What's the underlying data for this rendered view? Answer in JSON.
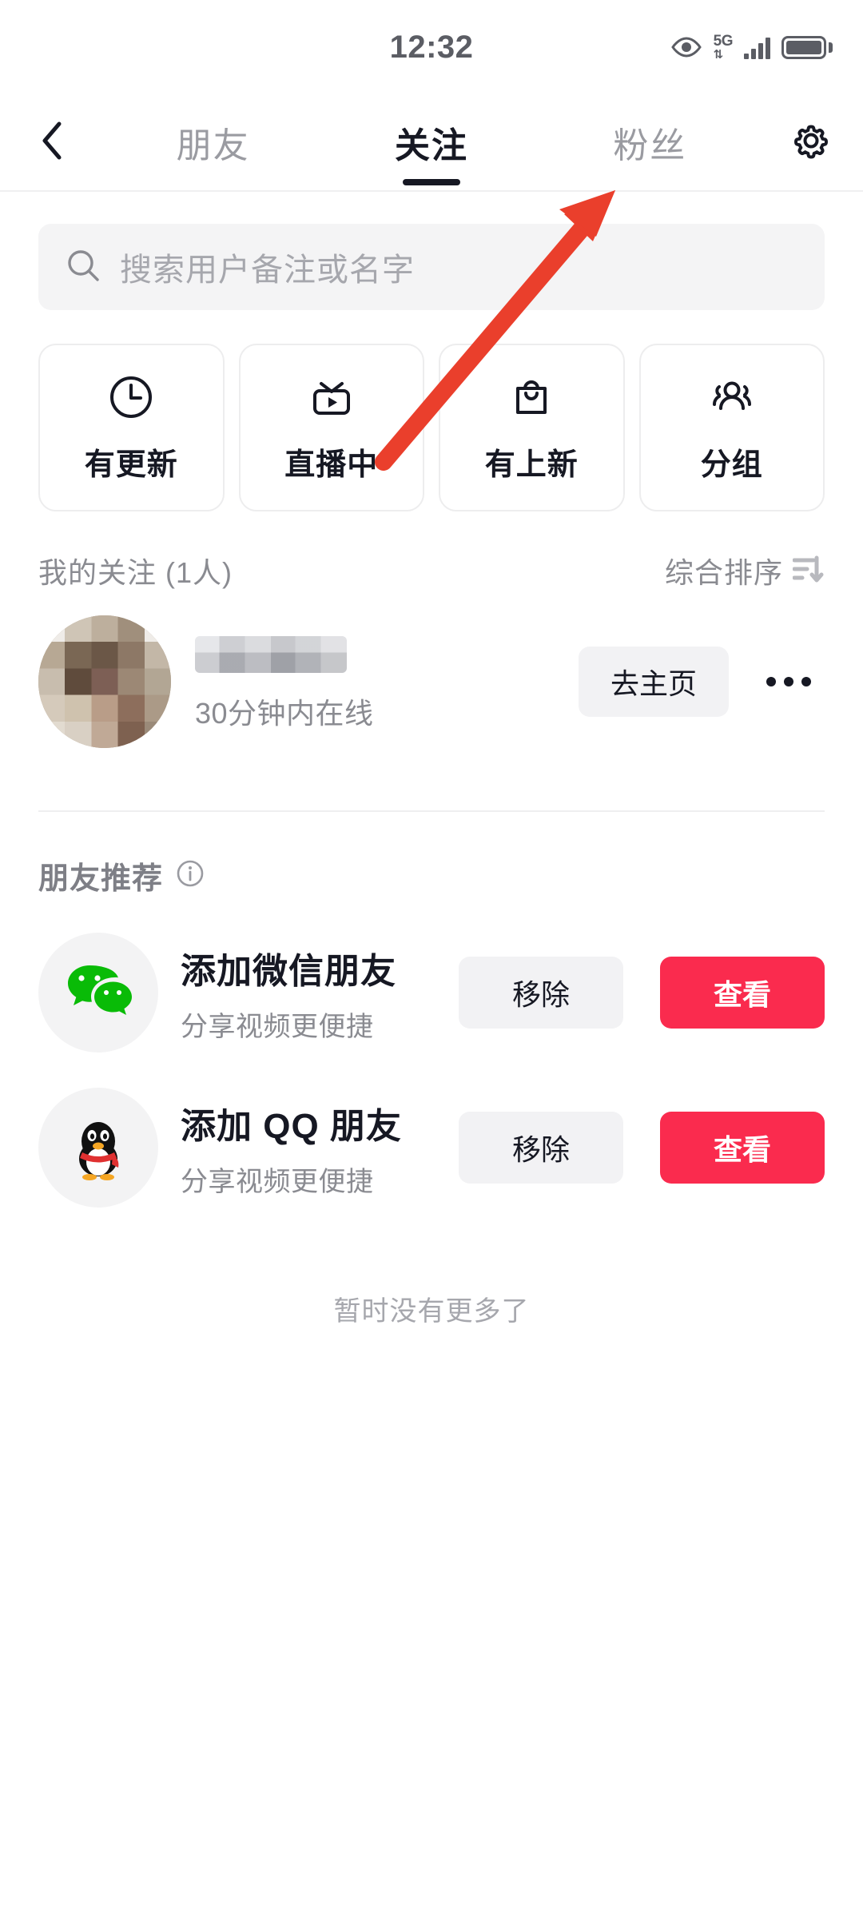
{
  "status_bar": {
    "time": "12:32",
    "network_label": "5G",
    "network_arrows": "⇅",
    "icons": [
      "eye-icon",
      "signal-icon",
      "battery-icon"
    ]
  },
  "header": {
    "back_icon": "chevron-left-icon",
    "settings_icon": "gear-icon",
    "tabs": [
      {
        "label": "朋友",
        "active": false
      },
      {
        "label": "关注",
        "active": true
      },
      {
        "label": "粉丝",
        "active": false
      }
    ]
  },
  "search": {
    "icon": "search-icon",
    "placeholder": "搜索用户备注或名字",
    "value": ""
  },
  "quick_actions": [
    {
      "label": "有更新",
      "icon": "clock-icon"
    },
    {
      "label": "直播中",
      "icon": "live-tv-icon"
    },
    {
      "label": "有上新",
      "icon": "shopping-bag-icon"
    },
    {
      "label": "分组",
      "icon": "people-group-icon"
    }
  ],
  "following_section": {
    "title": "我的关注 (1人)",
    "sort_label": "综合排序",
    "sort_icon": "sort-icon",
    "rows": [
      {
        "name": "",
        "name_redacted": true,
        "status": "30分钟内在线",
        "action_label": "去主页",
        "more_icon": "more-dots-icon",
        "avatar": "pixelated-photo"
      }
    ]
  },
  "recommend_section": {
    "title": "朋友推荐",
    "info_icon": "info-icon",
    "items": [
      {
        "icon": "wechat-icon",
        "name": "添加微信朋友",
        "subtitle": "分享视频更便捷",
        "dismiss_label": "移除",
        "primary_label": "查看"
      },
      {
        "icon": "qq-penguin-icon",
        "name": "添加 QQ 朋友",
        "subtitle": "分享视频更便捷",
        "dismiss_label": "移除",
        "primary_label": "查看"
      }
    ]
  },
  "footer": {
    "end_text": "暂时没有更多了"
  },
  "annotation": {
    "type": "arrow",
    "color": "#ea3f2c",
    "points_to": "粉丝"
  },
  "colors": {
    "primary_red": "#fa2b4e",
    "text_dark": "#161823",
    "text_muted": "#8a8b91",
    "field_bg": "#f4f4f5",
    "wechat_green": "#09bb07"
  }
}
